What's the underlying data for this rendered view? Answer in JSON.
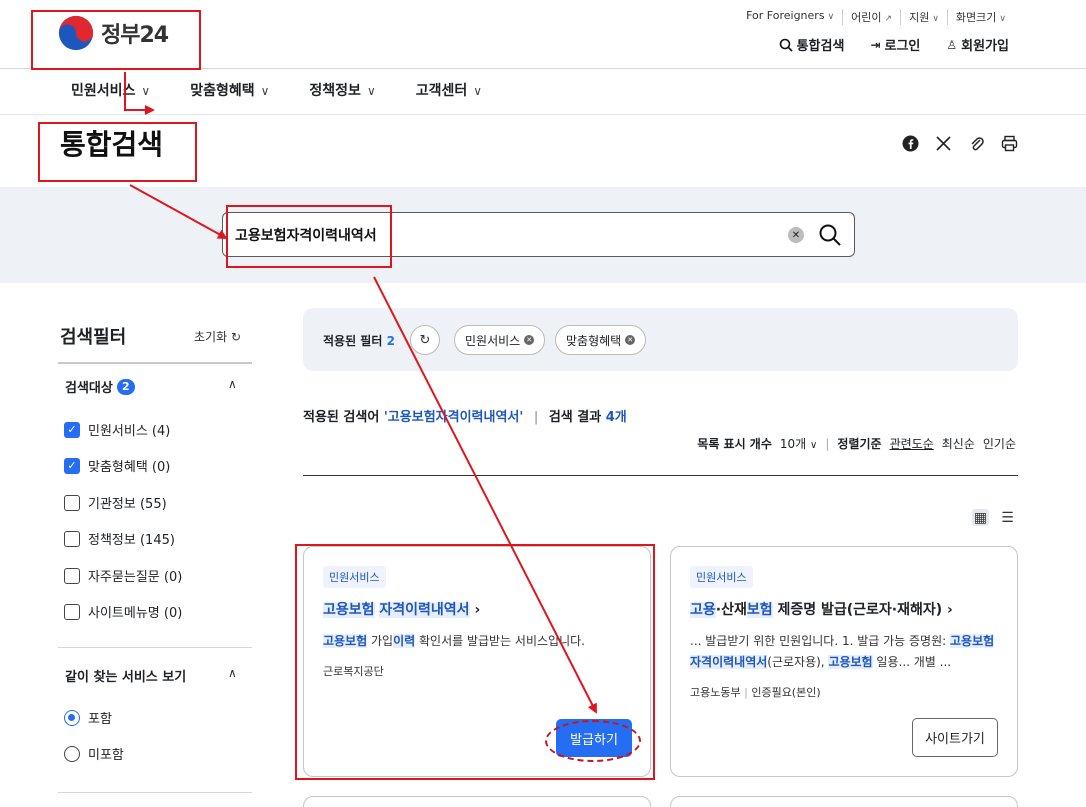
{
  "header": {
    "logo_text": "정부24",
    "util": [
      "For Foreigners",
      "어린이",
      "지원",
      "화면크기"
    ],
    "actions": [
      "통합검색",
      "로그인",
      "회원가입"
    ]
  },
  "gnb": [
    "민원서비스",
    "맞춤형혜택",
    "정책정보",
    "고객센터"
  ],
  "page_title": "통합검색",
  "share_icons": [
    "facebook-icon",
    "x-icon",
    "link-icon",
    "print-icon"
  ],
  "search": {
    "value": "고용보험자격이력내역서"
  },
  "filter": {
    "title": "검색필터",
    "reset": "초기화",
    "target_title": "검색대상",
    "target_count": "2",
    "items": [
      {
        "label": "민원서비스 (4)",
        "checked": true
      },
      {
        "label": "맞춤형혜택 (0)",
        "checked": true
      },
      {
        "label": "기관정보 (55)",
        "checked": false
      },
      {
        "label": "정책정보 (145)",
        "checked": false
      },
      {
        "label": "자주묻는질문 (0)",
        "checked": false
      },
      {
        "label": "사이트메뉴명 (0)",
        "checked": false
      }
    ],
    "related_title": "같이 찾는 서비스 보기",
    "radios": [
      {
        "label": "포함",
        "checked": true
      },
      {
        "label": "미포함",
        "checked": false
      }
    ]
  },
  "applied": {
    "label": "적용된 필터",
    "count": "2",
    "chips": [
      "민원서비스",
      "맞춤형혜택"
    ]
  },
  "result": {
    "label": "적용된 검색어",
    "keyword": "'고용보험자격이력내역서'",
    "count_label": "검색 결과",
    "count": "4개"
  },
  "sort": {
    "per_page_label": "목록 표시 개수",
    "per_page": "10개",
    "sort_label": "정렬기준",
    "options": [
      "관련도순",
      "최신순",
      "인기순"
    ]
  },
  "cards": [
    {
      "tag": "민원서비스",
      "title_hl1": "고용보험",
      "title_hl2": "자격이력내역서",
      "desc_hl1": "고용보험",
      "desc_t1": " 가입",
      "desc_hl2": "이력",
      "desc_t2": " 확인서를 발급받는 서비스입니다.",
      "meta": "근로복지공단",
      "button": "발급하기"
    },
    {
      "tag": "민원서비스",
      "title_hl1": "고용",
      "title_t1": "·산재",
      "title_hl2": "보험",
      "title_t2": " 제증명 발급(근로자·재해자)",
      "desc_t1": "... 발급받기 위한 민원입니다. 1. 발급 가능 증명원: ",
      "desc_hl1": "고용",
      "desc_hl2": "보험 자격이력내역서",
      "desc_t2": "(근로자용), ",
      "desc_hl3": "고용보험",
      "desc_t3": " 일용... 개별 ...",
      "meta1": "고용노동부",
      "meta2": "인증필요(본인)",
      "button": "사이트가기"
    }
  ]
}
